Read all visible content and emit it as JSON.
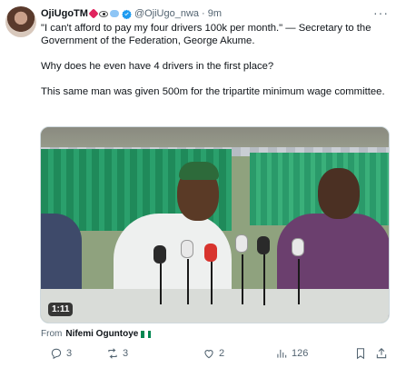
{
  "tweet": {
    "display_name": "OjiUgoTM",
    "handle": "@OjiUgo_nwa",
    "separator": "·",
    "time": "9m",
    "more_label": "···",
    "paragraphs": [
      "\"I can't afford to pay my four drivers 100k per month.\" — Secretary to the Government of the Federation, George Akume.",
      "Why does he even have 4 drivers in the first place?",
      "This same man was given 500m for the tripartite minimum wage committee."
    ]
  },
  "video": {
    "duration": "1:11"
  },
  "source": {
    "prefix": "From",
    "name": "Nifemi Oguntoye"
  },
  "actions": {
    "replies": "3",
    "retweets": "3",
    "likes": "2",
    "views": "126"
  },
  "icons": [
    "verified-badge-icon",
    "reply-icon",
    "retweet-icon",
    "like-icon",
    "views-icon",
    "bookmark-icon",
    "share-icon"
  ],
  "colors": {
    "text": "#0f1419",
    "secondary": "#536471",
    "verified": "#1d9bf0"
  }
}
